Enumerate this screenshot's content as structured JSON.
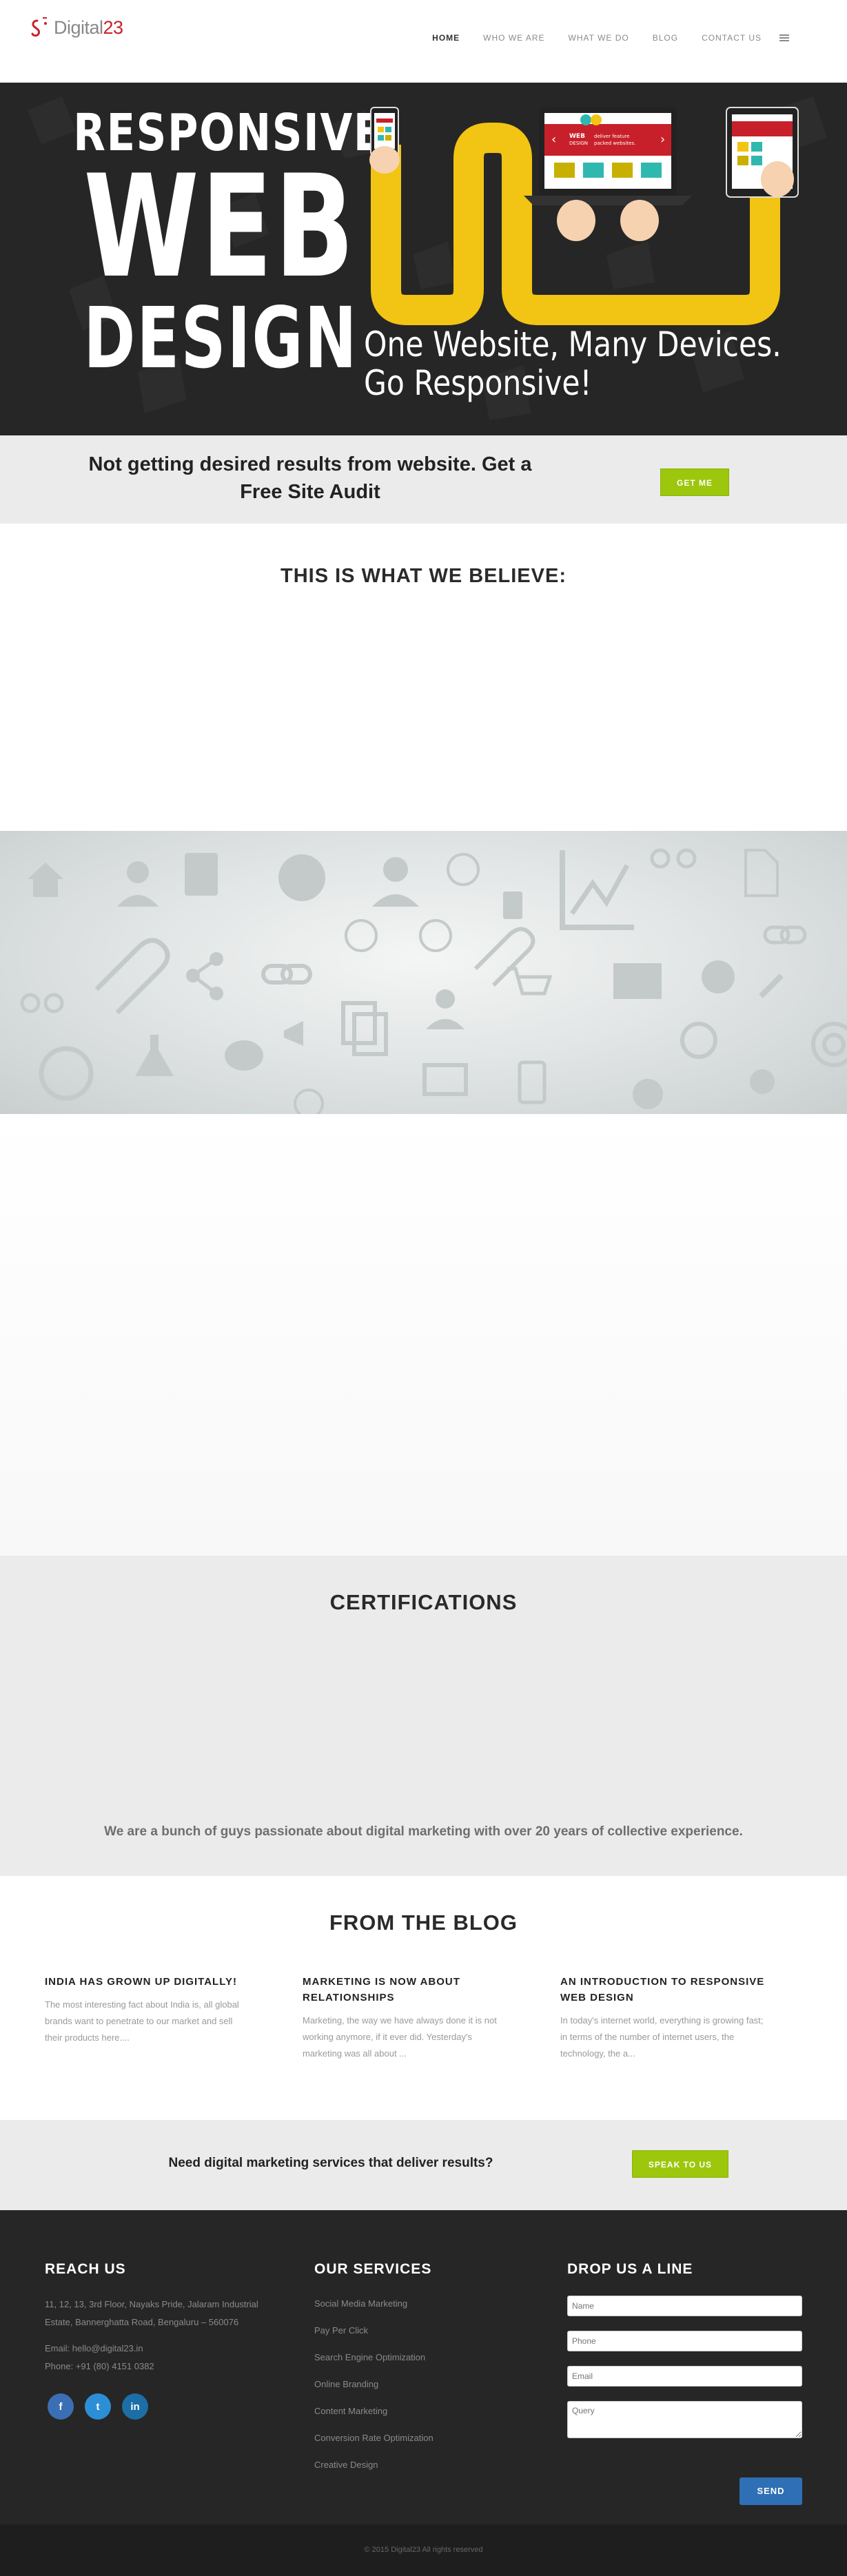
{
  "header": {
    "logo_text": "Digital",
    "logo_num": "23",
    "nav": [
      {
        "label": "HOME",
        "active": true
      },
      {
        "label": "WHO WE ARE",
        "active": false
      },
      {
        "label": "WHAT WE DO",
        "active": false
      },
      {
        "label": "BLOG",
        "active": false
      },
      {
        "label": "CONTACT US",
        "active": false
      }
    ]
  },
  "hero": {
    "line1": "RESPONSIVE",
    "line2": "WEB",
    "line3": "DESIGN",
    "tagline1": "One Website, Many Devices.",
    "tagline2": "Go Responsive!",
    "laptop_badge": "WEB DESIGN",
    "laptop_text": "deliver feature packed websites.",
    "accent_color": "#f2c413"
  },
  "audit": {
    "text": "Not getting desired results from website. Get a Free Site Audit",
    "button": "GET ME"
  },
  "believe": {
    "title": "THIS IS WHAT WE BELIEVE:"
  },
  "certifications": {
    "title": "CERTIFICATIONS",
    "subtitle": "We are a bunch of guys passionate about digital marketing with over 20 years of collective experience."
  },
  "blog": {
    "title": "FROM THE BLOG",
    "posts": [
      {
        "title": "INDIA HAS GROWN UP DIGITALLY!",
        "excerpt": "The most interesting fact about India is, all global brands want to penetrate to our market and sell their products here...."
      },
      {
        "title": "MARKETING IS NOW ABOUT RELATIONSHIPS",
        "excerpt": "Marketing, the way we have always done it is not working anymore, if it ever did. Yesterday's marketing was all about ..."
      },
      {
        "title": "AN INTRODUCTION TO RESPONSIVE WEB DESIGN",
        "excerpt": "In today's internet world, everything is growing fast; in terms of the number of internet users, the technology, the a..."
      }
    ]
  },
  "speak": {
    "text": "Need digital marketing services that deliver results?",
    "button": "SPEAK TO US"
  },
  "footer": {
    "reach": {
      "title": "REACH US",
      "address": "11, 12, 13, 3rd Floor, Nayaks Pride, Jalaram Industrial Estate, Bannerghatta Road, Bengaluru – 560076",
      "email": "Email: hello@digital23.in",
      "phone": "Phone: +91 (80) 4151 0382",
      "social": [
        "f",
        "t",
        "in"
      ]
    },
    "services": {
      "title": "OUR SERVICES",
      "items": [
        "Social Media Marketing",
        "Pay Per Click",
        "Search Engine Optimization",
        "Online Branding",
        "Content Marketing",
        "Conversion Rate Optimization",
        "Creative Design"
      ]
    },
    "drop": {
      "title": "DROP US A LINE",
      "name_placeholder": "Name",
      "phone_placeholder": "Phone",
      "email_placeholder": "Email",
      "query_placeholder": "Query",
      "send": "SEND"
    },
    "copyright": "© 2015 Digital23 All rights reserved"
  },
  "colors": {
    "green_button": "#9cc70c",
    "logo_red": "#c8202a",
    "send_blue": "#2f6fb5"
  }
}
